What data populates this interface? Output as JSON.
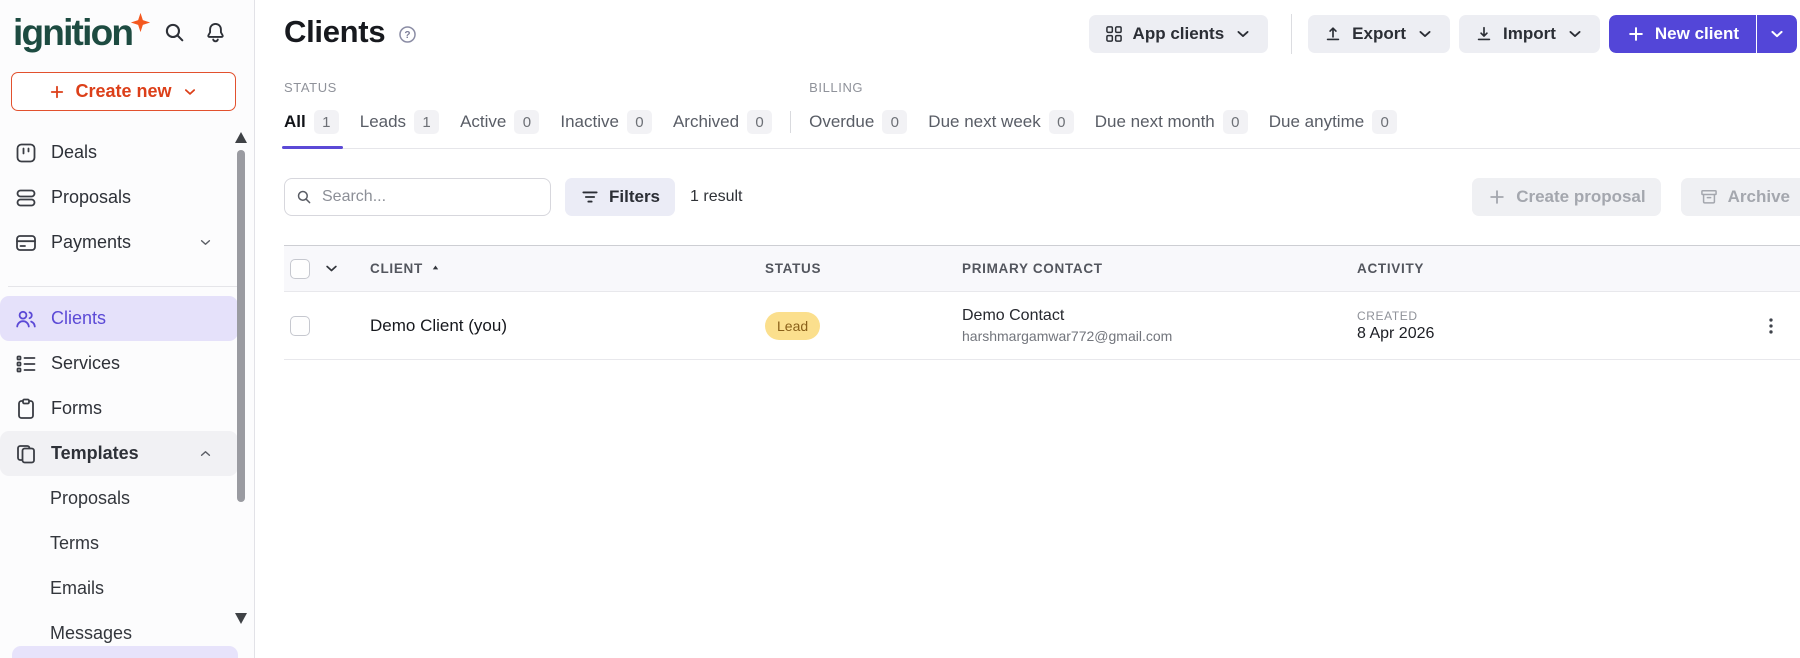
{
  "brand": {
    "logo_text": "ignition"
  },
  "sidebar": {
    "create_new_label": "Create new",
    "nav": [
      {
        "label": "Deals"
      },
      {
        "label": "Proposals"
      },
      {
        "label": "Payments"
      },
      {
        "label": "Clients"
      },
      {
        "label": "Services"
      },
      {
        "label": "Forms"
      },
      {
        "label": "Templates"
      }
    ],
    "sub_nav": [
      {
        "label": "Proposals"
      },
      {
        "label": "Terms"
      },
      {
        "label": "Emails"
      },
      {
        "label": "Messages"
      }
    ]
  },
  "header": {
    "title": "Clients",
    "app_clients_label": "App clients",
    "export_label": "Export",
    "import_label": "Import",
    "new_client_label": "New client"
  },
  "filters": {
    "status_label": "STATUS",
    "billing_label": "BILLING",
    "status_tabs": [
      {
        "label": "All",
        "count": "1"
      },
      {
        "label": "Leads",
        "count": "1"
      },
      {
        "label": "Active",
        "count": "0"
      },
      {
        "label": "Inactive",
        "count": "0"
      },
      {
        "label": "Archived",
        "count": "0"
      }
    ],
    "billing_tabs": [
      {
        "label": "Overdue",
        "count": "0"
      },
      {
        "label": "Due next week",
        "count": "0"
      },
      {
        "label": "Due next month",
        "count": "0"
      },
      {
        "label": "Due anytime",
        "count": "0"
      }
    ]
  },
  "toolbar": {
    "search_placeholder": "Search...",
    "filters_label": "Filters",
    "result_text": "1 result",
    "create_proposal_label": "Create proposal",
    "archive_label": "Archive"
  },
  "table": {
    "columns": [
      "CLIENT",
      "STATUS",
      "PRIMARY CONTACT",
      "ACTIVITY"
    ],
    "rows": [
      {
        "client": "Demo Client (you)",
        "status": "Lead",
        "contact_name": "Demo Contact",
        "contact_email": "harshmargamwar772@gmail.com",
        "activity_label": "CREATED",
        "activity_date": "8 Apr 2026"
      }
    ]
  },
  "colors": {
    "brand_green": "#1d4b41",
    "brand_orange": "#f4581f",
    "create_new_red": "#dc3f19",
    "accent_purple": "#5346d8",
    "nav_selected_bg": "#e5e1fa",
    "lead_badge_bg": "#fbdf8d",
    "lead_badge_text": "#8a6019",
    "table_header_bg": "#f8f8fb"
  }
}
